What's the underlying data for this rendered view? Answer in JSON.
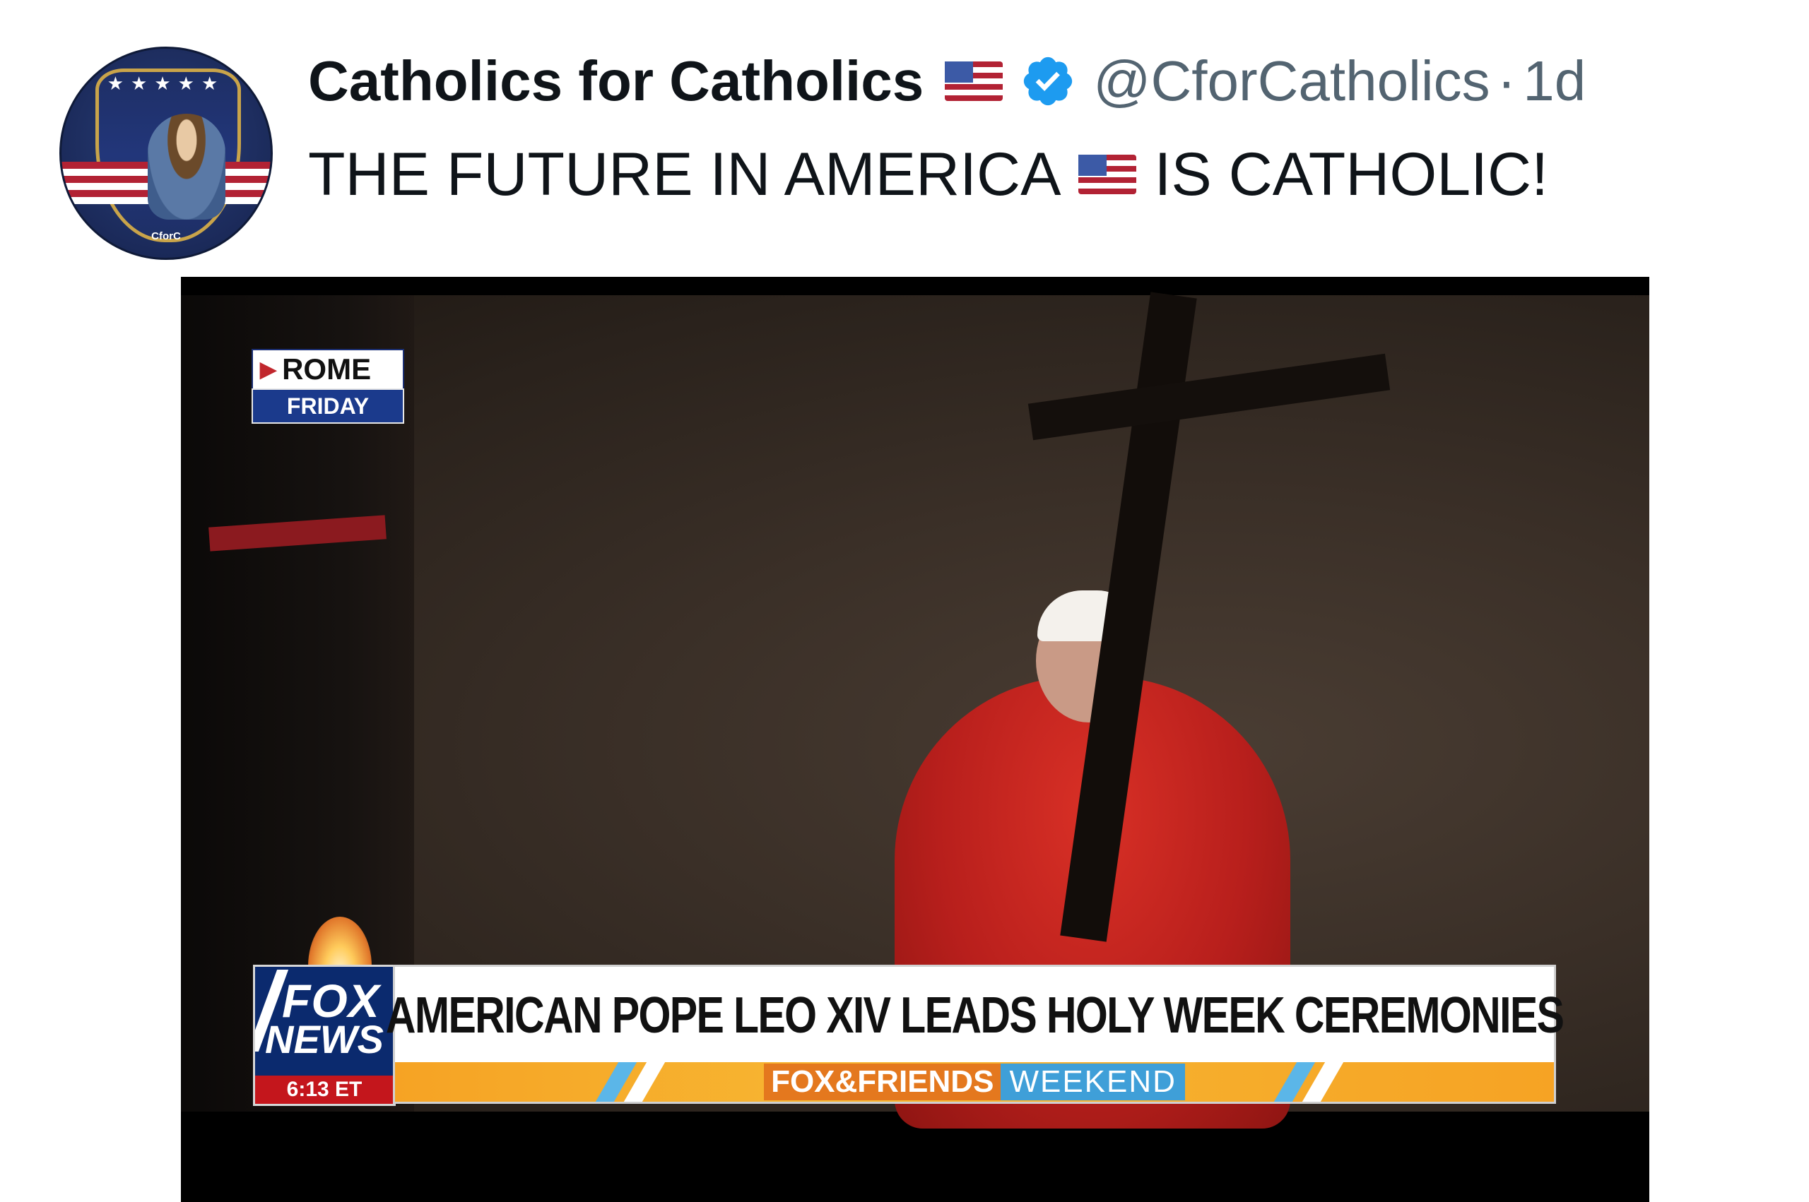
{
  "tweet": {
    "author_name": "Catholics for Catholics",
    "handle": "@CforCatholics",
    "separator": "·",
    "time": "1d",
    "text_before": "THE FUTURE IN AMERICA",
    "text_after": "IS CATHOLIC!",
    "avatar_text": "CforC",
    "icons": [
      "us-flag-icon",
      "verified-badge-icon"
    ],
    "colors": {
      "verified": "#1d9bf0",
      "handle": "#536471"
    }
  },
  "video": {
    "location": "ROME",
    "day": "FRIDAY",
    "network": {
      "line1": "FOX",
      "line2": "NEWS",
      "clock": "6:13 ET"
    },
    "headline": "AMERICAN POPE LEO XIV LEADS HOLY WEEK CEREMONIES",
    "show": {
      "part1": "FOX&FRIENDS",
      "part2": "WEEKEND"
    }
  }
}
